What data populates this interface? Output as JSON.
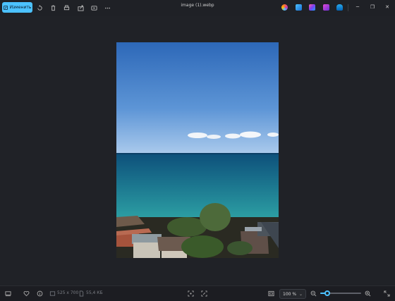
{
  "toolbar": {
    "edit_label": "Изменить",
    "icons": [
      "rotate-icon",
      "delete-icon",
      "print-icon",
      "share-icon",
      "slideshow-icon",
      "more-icon"
    ]
  },
  "window": {
    "title": "image (1).webp",
    "apps": [
      "copilot-icon",
      "clipchamp-icon",
      "paint-icon",
      "designer-icon",
      "onedrive-icon"
    ],
    "controls": {
      "minimize": "─",
      "maximize": "❐",
      "close": "✕"
    }
  },
  "statusbar": {
    "dimensions": "525 x 700",
    "filesize": "55,4 КБ",
    "zoom_value": "100 %",
    "zoom_caret": "⌄",
    "zoom_level": 0.18
  },
  "colors": {
    "accent": "#4cc2ff",
    "background": "#1f2126"
  }
}
